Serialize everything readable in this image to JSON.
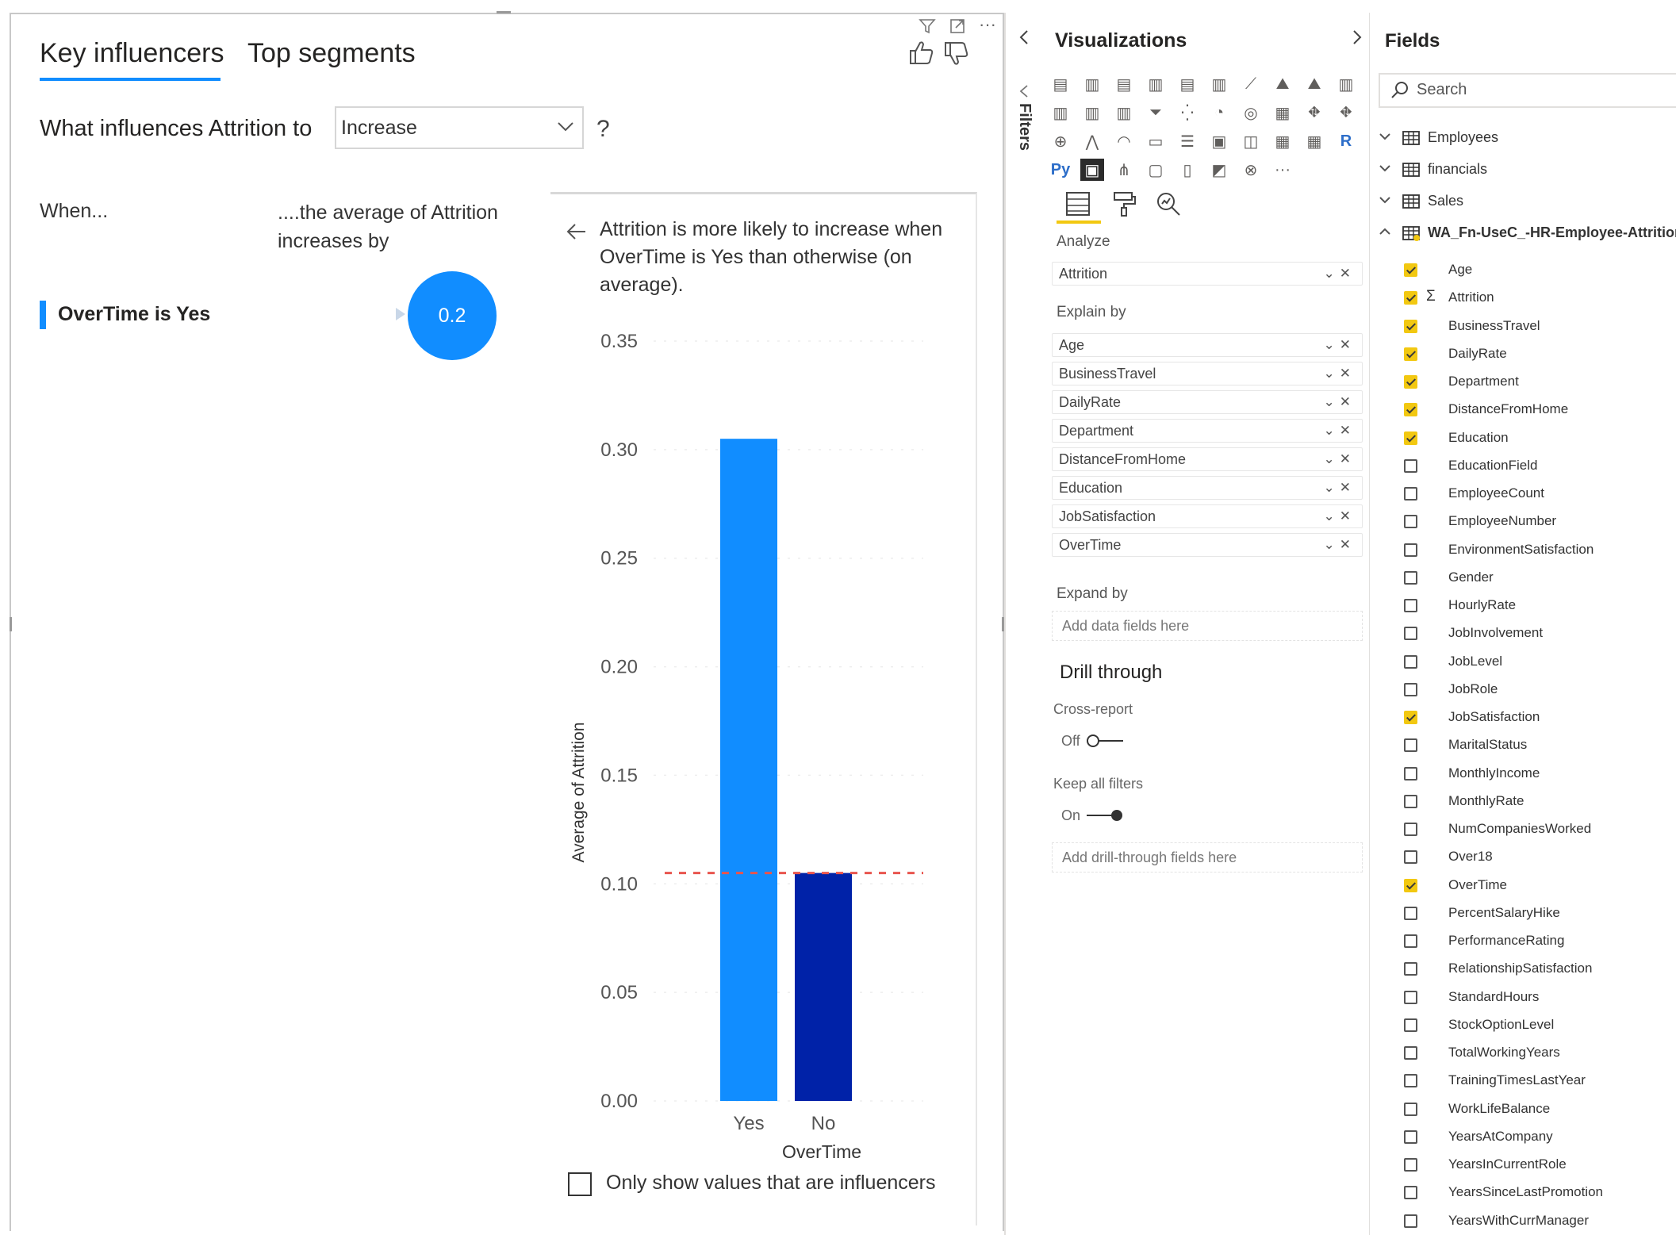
{
  "key_influencers": {
    "tabs": [
      {
        "label": "Key influencers",
        "active": true
      },
      {
        "label": "Top segments",
        "active": false
      }
    ],
    "question": "What influences Attrition to",
    "analyze_value": "Increase",
    "help": "?",
    "when_label": "When...",
    "avg_label": "....the average of Attrition increases by",
    "influencer": {
      "label": "OverTime is Yes",
      "value": "0.2"
    },
    "detail_text": "Attrition is more likely to increase when OverTime is Yes than otherwise (on average).",
    "only_influencers_label": "Only show values that are influencers",
    "only_influencers_checked": false
  },
  "chart_data": {
    "type": "bar",
    "categories": [
      "Yes",
      "No"
    ],
    "values": [
      0.305,
      0.105
    ],
    "colors": [
      "#118dff",
      "#0022a8"
    ],
    "average_line": 0.105,
    "average_line_color": "#e8554e",
    "xlabel": "OverTime",
    "ylabel": "Average of Attrition",
    "ylim": [
      0,
      0.35
    ],
    "yticks": [
      "0.00",
      "0.05",
      "0.10",
      "0.15",
      "0.20",
      "0.25",
      "0.30",
      "0.35"
    ],
    "grid": true
  },
  "visualizations": {
    "title": "Visualizations",
    "filters_label": "Filters",
    "analyze_label": "Analyze",
    "analyze_field": "Attrition",
    "explain_by_label": "Explain by",
    "explain_by": [
      "Age",
      "BusinessTravel",
      "DailyRate",
      "Department",
      "DistanceFromHome",
      "Education",
      "JobSatisfaction",
      "OverTime"
    ],
    "expand_by_label": "Expand by",
    "expand_placeholder": "Add data fields here",
    "drill_through_label": "Drill through",
    "cross_report_label": "Cross-report",
    "cross_report_state": "Off",
    "keep_filters_label": "Keep all filters",
    "keep_filters_state": "On",
    "drill_placeholder": "Add drill-through fields here",
    "more": "···"
  },
  "fields": {
    "title": "Fields",
    "search_placeholder": "Search",
    "tables": [
      {
        "name": "Employees",
        "expanded": false
      },
      {
        "name": "financials",
        "expanded": false
      },
      {
        "name": "Sales",
        "expanded": false
      },
      {
        "name": "WA_Fn-UseC_-HR-Employee-Attrition",
        "expanded": true
      }
    ],
    "items": [
      {
        "name": "Age",
        "checked": true
      },
      {
        "name": "Attrition",
        "checked": true,
        "sigma": true
      },
      {
        "name": "BusinessTravel",
        "checked": true
      },
      {
        "name": "DailyRate",
        "checked": true
      },
      {
        "name": "Department",
        "checked": true
      },
      {
        "name": "DistanceFromHome",
        "checked": true
      },
      {
        "name": "Education",
        "checked": true
      },
      {
        "name": "EducationField",
        "checked": false
      },
      {
        "name": "EmployeeCount",
        "checked": false
      },
      {
        "name": "EmployeeNumber",
        "checked": false
      },
      {
        "name": "EnvironmentSatisfaction",
        "checked": false
      },
      {
        "name": "Gender",
        "checked": false
      },
      {
        "name": "HourlyRate",
        "checked": false
      },
      {
        "name": "JobInvolvement",
        "checked": false
      },
      {
        "name": "JobLevel",
        "checked": false
      },
      {
        "name": "JobRole",
        "checked": false
      },
      {
        "name": "JobSatisfaction",
        "checked": true
      },
      {
        "name": "MaritalStatus",
        "checked": false
      },
      {
        "name": "MonthlyIncome",
        "checked": false
      },
      {
        "name": "MonthlyRate",
        "checked": false
      },
      {
        "name": "NumCompaniesWorked",
        "checked": false
      },
      {
        "name": "Over18",
        "checked": false
      },
      {
        "name": "OverTime",
        "checked": true
      },
      {
        "name": "PercentSalaryHike",
        "checked": false
      },
      {
        "name": "PerformanceRating",
        "checked": false
      },
      {
        "name": "RelationshipSatisfaction",
        "checked": false
      },
      {
        "name": "StandardHours",
        "checked": false
      },
      {
        "name": "StockOptionLevel",
        "checked": false
      },
      {
        "name": "TotalWorkingYears",
        "checked": false
      },
      {
        "name": "TrainingTimesLastYear",
        "checked": false
      },
      {
        "name": "WorkLifeBalance",
        "checked": false
      },
      {
        "name": "YearsAtCompany",
        "checked": false
      },
      {
        "name": "YearsInCurrentRole",
        "checked": false
      },
      {
        "name": "YearsSinceLastPromotion",
        "checked": false
      },
      {
        "name": "YearsWithCurrManager",
        "checked": false
      }
    ]
  }
}
